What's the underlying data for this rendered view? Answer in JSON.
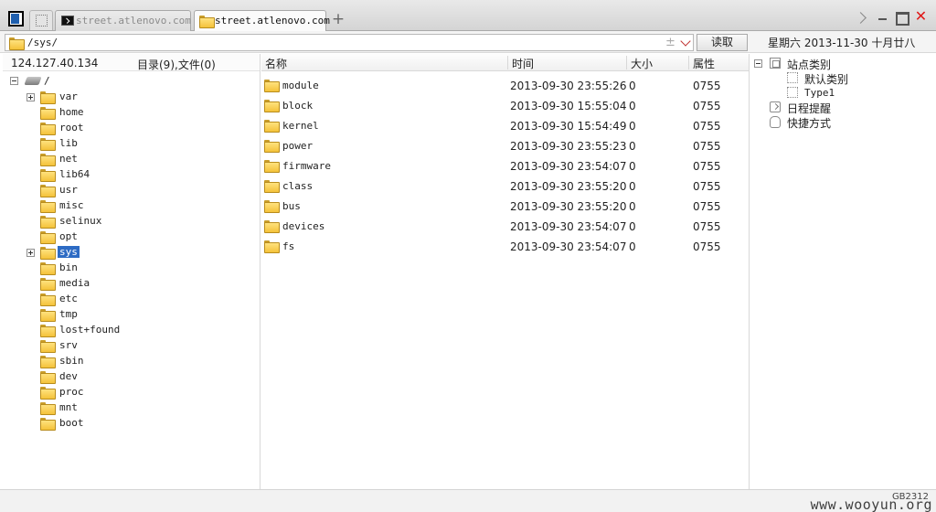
{
  "tabs": [
    {
      "label": "street.atlenovo.com",
      "active": false
    },
    {
      "label": "street.atlenovo.com",
      "active": true
    }
  ],
  "address": {
    "path": "/sys/",
    "plus_minus": "±",
    "read_label": "读取"
  },
  "date_text": "星期六  2013-11-30  十月廿八",
  "left": {
    "ip": "124.127.40.134",
    "counts": "目录(9),文件(0)",
    "root_label": "/",
    "items": [
      "var",
      "home",
      "root",
      "lib",
      "net",
      "lib64",
      "usr",
      "misc",
      "selinux",
      "opt",
      "sys",
      "bin",
      "media",
      "etc",
      "tmp",
      "lost+found",
      "srv",
      "sbin",
      "dev",
      "proc",
      "mnt",
      "boot"
    ]
  },
  "columns": {
    "name": "名称",
    "time": "时间",
    "size": "大小",
    "attr": "属性"
  },
  "files": [
    {
      "name": "module",
      "time": "2013-09-30 23:55:26",
      "size": "0",
      "attr": "0755"
    },
    {
      "name": "block",
      "time": "2013-09-30 15:55:04",
      "size": "0",
      "attr": "0755"
    },
    {
      "name": "kernel",
      "time": "2013-09-30 15:54:49",
      "size": "0",
      "attr": "0755"
    },
    {
      "name": "power",
      "time": "2013-09-30 23:55:23",
      "size": "0",
      "attr": "0755"
    },
    {
      "name": "firmware",
      "time": "2013-09-30 23:54:07",
      "size": "0",
      "attr": "0755"
    },
    {
      "name": "class",
      "time": "2013-09-30 23:55:20",
      "size": "0",
      "attr": "0755"
    },
    {
      "name": "bus",
      "time": "2013-09-30 23:55:20",
      "size": "0",
      "attr": "0755"
    },
    {
      "name": "devices",
      "time": "2013-09-30 23:54:07",
      "size": "0",
      "attr": "0755"
    },
    {
      "name": "fs",
      "time": "2013-09-30 23:54:07",
      "size": "0",
      "attr": "0755"
    }
  ],
  "right": {
    "site_category": "站点类别",
    "default_category": "默认类别",
    "type1": "Type1",
    "schedule": "日程提醒",
    "shortcut": "快捷方式"
  },
  "status": {
    "encoding": "GB2312",
    "watermark": "www.wooyun.org"
  },
  "colors": {
    "selection": "#2d6bc4",
    "folder": "#f4c23a",
    "close": "#e01818"
  }
}
